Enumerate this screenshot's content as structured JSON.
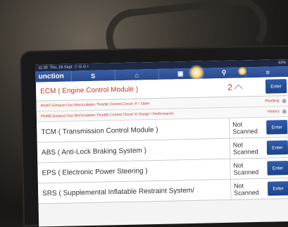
{
  "status_bar": {
    "time": "11:30",
    "date": "Thu, 26 Sept",
    "indicators": "☉ G ⊙ •",
    "battery": "60%"
  },
  "nav": {
    "title": "unction",
    "tabs": [
      "S",
      "home",
      "doc",
      "user",
      "menu"
    ]
  },
  "systems": [
    {
      "name": "ECM ( Engine Control Module )",
      "count": "2",
      "status": "",
      "enter": "Enter"
    },
    {
      "name": "TCM ( Transmission Control Module )",
      "status": "Not Scanned",
      "enter": "Enter"
    },
    {
      "name": "ABS ( Anti-Lock Braking System )",
      "status": "Not Scanned",
      "enter": "Enter"
    },
    {
      "name": "EPS ( Electronic Power Steering )",
      "status": "Not Scanned",
      "enter": "Enter"
    },
    {
      "name": "SRS ( Supplemental Inflatable Restraint System/",
      "status": "Not Scanned",
      "enter": "Enter"
    }
  ],
  "dtcs": [
    {
      "text": "P0487 Exhaust Gas Recirculation Throttle Control Circuit 'A' / Open",
      "state": "Pending"
    },
    {
      "text": "P0488 Exhaust Gas Recirculation Throttle Control Circuit 'A' Range / Performance",
      "state": "History"
    }
  ],
  "colors": {
    "nav": "#2a4a8e",
    "enter_button": "#1e4288",
    "fault_text": "#c0392b"
  }
}
